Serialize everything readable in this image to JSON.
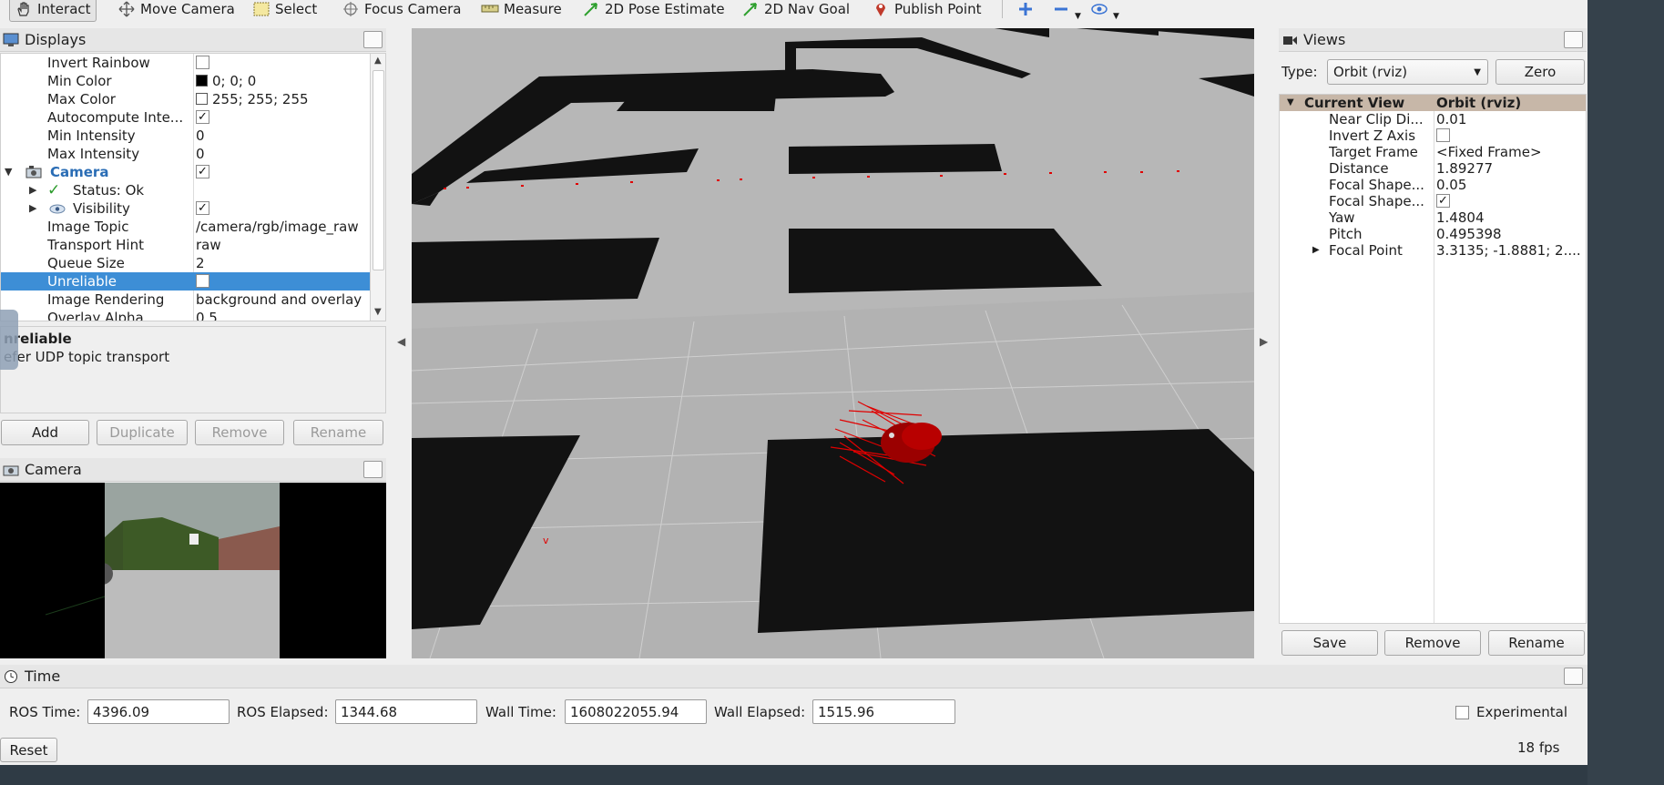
{
  "toolbar": {
    "tools": [
      {
        "label": "Interact",
        "icon": "hand-icon"
      },
      {
        "label": "Move Camera",
        "icon": "move-camera-icon"
      },
      {
        "label": "Select",
        "icon": "select-icon"
      },
      {
        "label": "Focus Camera",
        "icon": "focus-camera-icon"
      },
      {
        "label": "Measure",
        "icon": "measure-icon"
      },
      {
        "label": "2D Pose Estimate",
        "icon": "pose-arrow-icon"
      },
      {
        "label": "2D Nav Goal",
        "icon": "nav-goal-icon"
      },
      {
        "label": "Publish Point",
        "icon": "map-pin-icon"
      }
    ]
  },
  "displays": {
    "title": "Displays",
    "rows": [
      {
        "name": "Invert Rainbow",
        "value": ""
      },
      {
        "name": "Min Color",
        "value": "0; 0; 0"
      },
      {
        "name": "Max Color",
        "value": "255; 255; 255"
      },
      {
        "name": "Autocompute Inte...",
        "value": ""
      },
      {
        "name": "Min Intensity",
        "value": "0"
      },
      {
        "name": "Max Intensity",
        "value": "0"
      },
      {
        "name": "Camera",
        "value": ""
      },
      {
        "name": "Status: Ok",
        "value": ""
      },
      {
        "name": "Visibility",
        "value": ""
      },
      {
        "name": "Image Topic",
        "value": "/camera/rgb/image_raw"
      },
      {
        "name": "Transport Hint",
        "value": "raw"
      },
      {
        "name": "Queue Size",
        "value": "2"
      },
      {
        "name": "Unreliable",
        "value": ""
      },
      {
        "name": "Image Rendering",
        "value": "background and overlay"
      },
      {
        "name": "Overlay Alpha",
        "value": "0.5"
      }
    ],
    "help_title": "nreliable",
    "help_text": "efer UDP topic transport",
    "buttons": {
      "add": "Add",
      "duplicate": "Duplicate",
      "remove": "Remove",
      "rename": "Rename"
    }
  },
  "camera_panel": {
    "title": "Camera"
  },
  "views": {
    "title": "Views",
    "type_label": "Type:",
    "type_value": "Orbit (rviz)",
    "zero_label": "Zero",
    "header_name": "Current View",
    "header_value": "Orbit (rviz)",
    "rows": [
      {
        "name": "Near Clip Di...",
        "value": "0.01"
      },
      {
        "name": "Invert Z Axis",
        "value": ""
      },
      {
        "name": "Target Frame",
        "value": "<Fixed Frame>"
      },
      {
        "name": "Distance",
        "value": "1.89277"
      },
      {
        "name": "Focal Shape...",
        "value": "0.05"
      },
      {
        "name": "Focal Shape...",
        "value": ""
      },
      {
        "name": "Yaw",
        "value": "1.4804"
      },
      {
        "name": "Pitch",
        "value": "0.495398"
      },
      {
        "name": "Focal Point",
        "value": "3.3135; -1.8881; 2...."
      }
    ],
    "buttons": {
      "save": "Save",
      "remove": "Remove",
      "rename": "Rename"
    }
  },
  "time": {
    "title": "Time",
    "ros_time_label": "ROS Time:",
    "ros_time": "4396.09",
    "ros_elapsed_label": "ROS Elapsed:",
    "ros_elapsed": "1344.68",
    "wall_time_label": "Wall Time:",
    "wall_time": "1608022055.94",
    "wall_elapsed_label": "Wall Elapsed:",
    "wall_elapsed": "1515.96",
    "experimental_label": "Experimental",
    "reset_label": "Reset",
    "fps": "18 fps"
  },
  "colors": {
    "selection": "#3d8ed6",
    "camera_label": "#2a6db5",
    "particles": "#e00000"
  }
}
